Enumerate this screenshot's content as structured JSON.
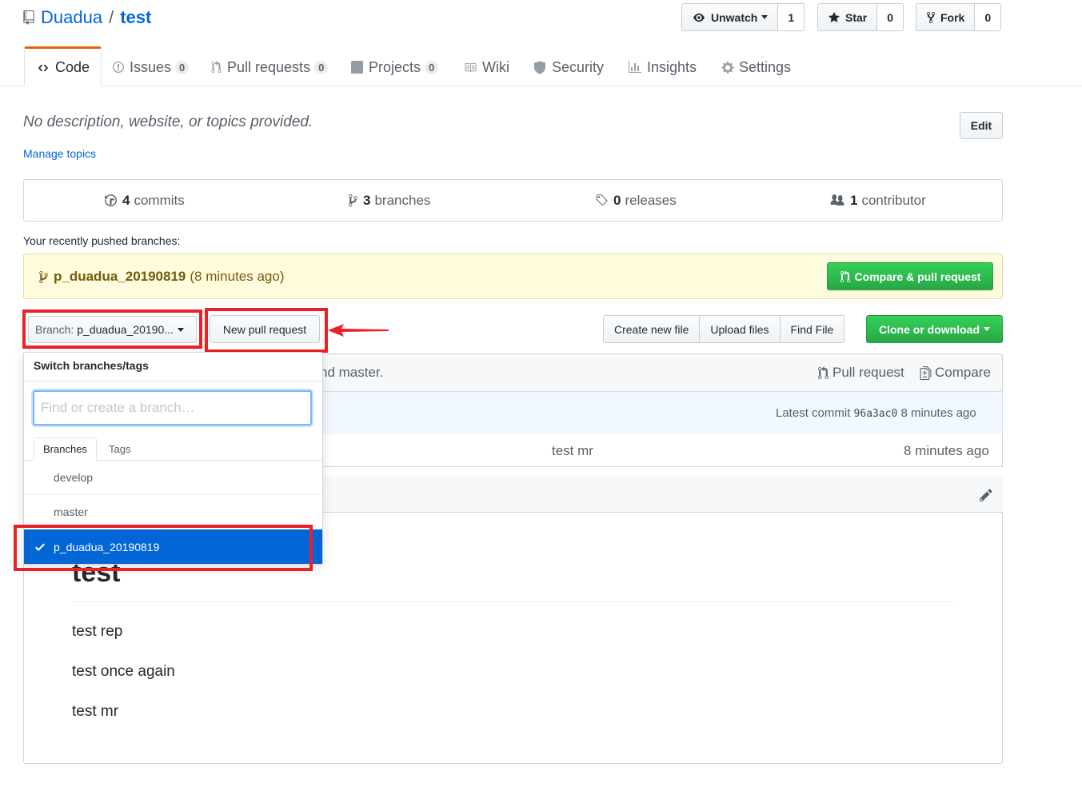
{
  "repo": {
    "owner": "Duadua",
    "separator": "/",
    "name": "test"
  },
  "actions": {
    "watch": {
      "label": "Unwatch",
      "count": "1"
    },
    "star": {
      "label": "Star",
      "count": "0"
    },
    "fork": {
      "label": "Fork",
      "count": "0"
    }
  },
  "tabs": [
    {
      "label": "Code",
      "icon": "code-icon"
    },
    {
      "label": "Issues",
      "count": "0",
      "icon": "issue-icon"
    },
    {
      "label": "Pull requests",
      "count": "0",
      "icon": "pull-request-icon"
    },
    {
      "label": "Projects",
      "count": "0",
      "icon": "project-icon"
    },
    {
      "label": "Wiki",
      "icon": "book-icon"
    },
    {
      "label": "Security",
      "icon": "shield-icon"
    },
    {
      "label": "Insights",
      "icon": "graph-icon"
    },
    {
      "label": "Settings",
      "icon": "gear-icon"
    }
  ],
  "description": "No description, website, or topics provided.",
  "manage_topics": "Manage topics",
  "edit_label": "Edit",
  "summary": {
    "commits": {
      "count": "4",
      "label": "commits"
    },
    "branches": {
      "count": "3",
      "label": "branches"
    },
    "releases": {
      "count": "0",
      "label": "releases"
    },
    "contributors": {
      "count": "1",
      "label": "contributor"
    }
  },
  "recent": {
    "label": "Your recently pushed branches:",
    "branch": "p_duadua_20190819",
    "ago": "(8 minutes ago)",
    "compare_label": "Compare & pull request"
  },
  "branch_select": {
    "prefix": "Branch:",
    "value": "p_duadua_20190..."
  },
  "new_pr_label": "New pull request",
  "file_actions": [
    "Create new file",
    "Upload files",
    "Find File"
  ],
  "clone_label": "Clone or download",
  "branch_info": {
    "text": "nd master.",
    "pull_request": "Pull request",
    "compare": "Compare"
  },
  "latest_commit": {
    "prefix": "Latest commit",
    "sha": "96a3ac0",
    "ago": "8 minutes ago"
  },
  "file_row": {
    "message": "test mr",
    "age": "8 minutes ago"
  },
  "readme": {
    "heading": "test",
    "paragraphs": [
      "test rep",
      "test once again",
      "test mr"
    ]
  },
  "dropdown": {
    "header": "Switch branches/tags",
    "placeholder": "Find or create a branch…",
    "tabs": [
      "Branches",
      "Tags"
    ],
    "items": [
      "develop",
      "master",
      "p_duadua_20190819"
    ],
    "selected": "p_duadua_20190819"
  },
  "colors": {
    "link": "#0366d6",
    "green": "#28a745",
    "annotation_red": "#ec2127",
    "selected_blue": "#0366d6",
    "recent_bg": "#fffbdd"
  }
}
